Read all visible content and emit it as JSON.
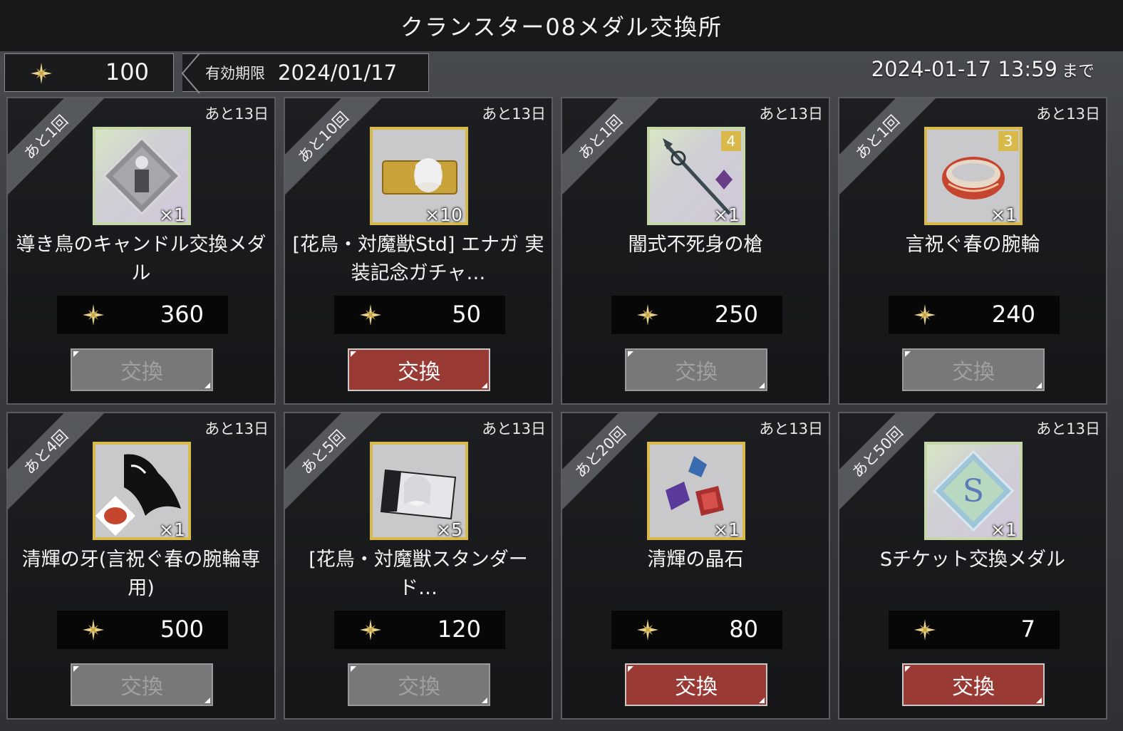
{
  "header": {
    "title": "クランスター08メダル交換所"
  },
  "currency": {
    "icon": "star-medal-icon",
    "amount": "100"
  },
  "expiry": {
    "label": "有効期限",
    "date": "2024/01/17"
  },
  "deadline": {
    "datetime": "2024-01-17 13:59",
    "suffix": "まで"
  },
  "colors": {
    "button_active": "#9a3a34",
    "button_disabled": "#77787a",
    "frame_gold": "#d9b94a"
  },
  "items": [
    {
      "remaining": "あと1回",
      "days": "あと13日",
      "name": "導き鳥のキャンドル交換メダル",
      "qty": "×1",
      "price": "360",
      "button": "交換",
      "enabled": false,
      "icon": "candle-medal-icon",
      "frame": "rainbow",
      "rank": ""
    },
    {
      "remaining": "あと10回",
      "days": "あと13日",
      "name": "[花鳥・対魔獣Std] エナガ 実装記念ガチャ…",
      "qty": "×10",
      "price": "50",
      "button": "交換",
      "enabled": true,
      "icon": "gacha-ticket-icon",
      "frame": "gold",
      "rank": ""
    },
    {
      "remaining": "あと1回",
      "days": "あと13日",
      "name": "闇式不死身の槍",
      "qty": "×1",
      "price": "250",
      "button": "交換",
      "enabled": false,
      "icon": "spear-icon",
      "frame": "rainbow",
      "rank": "4"
    },
    {
      "remaining": "あと1回",
      "days": "あと13日",
      "name": "言祝ぐ春の腕輪",
      "qty": "×1",
      "price": "240",
      "button": "交換",
      "enabled": false,
      "icon": "bracelet-icon",
      "frame": "gold",
      "rank": "3"
    },
    {
      "remaining": "あと4回",
      "days": "あと13日",
      "name": "清輝の牙(言祝ぐ春の腕輪専用)",
      "qty": "×1",
      "price": "500",
      "button": "交換",
      "enabled": false,
      "icon": "fang-icon",
      "frame": "gold",
      "rank": ""
    },
    {
      "remaining": "あと5回",
      "days": "あと13日",
      "name": "[花鳥・対魔獣スタンダード…",
      "qty": "×5",
      "price": "120",
      "button": "交換",
      "enabled": false,
      "icon": "character-ticket-icon",
      "frame": "gold",
      "rank": ""
    },
    {
      "remaining": "あと20回",
      "days": "あと13日",
      "name": "清輝の晶石",
      "qty": "×1",
      "price": "80",
      "button": "交換",
      "enabled": true,
      "icon": "crystal-icon",
      "frame": "gold",
      "rank": ""
    },
    {
      "remaining": "あと50回",
      "days": "あと13日",
      "name": "Sチケット交換メダル",
      "qty": "×1",
      "price": "7",
      "button": "交換",
      "enabled": true,
      "icon": "s-ticket-medal-icon",
      "frame": "rainbow",
      "rank": ""
    }
  ]
}
